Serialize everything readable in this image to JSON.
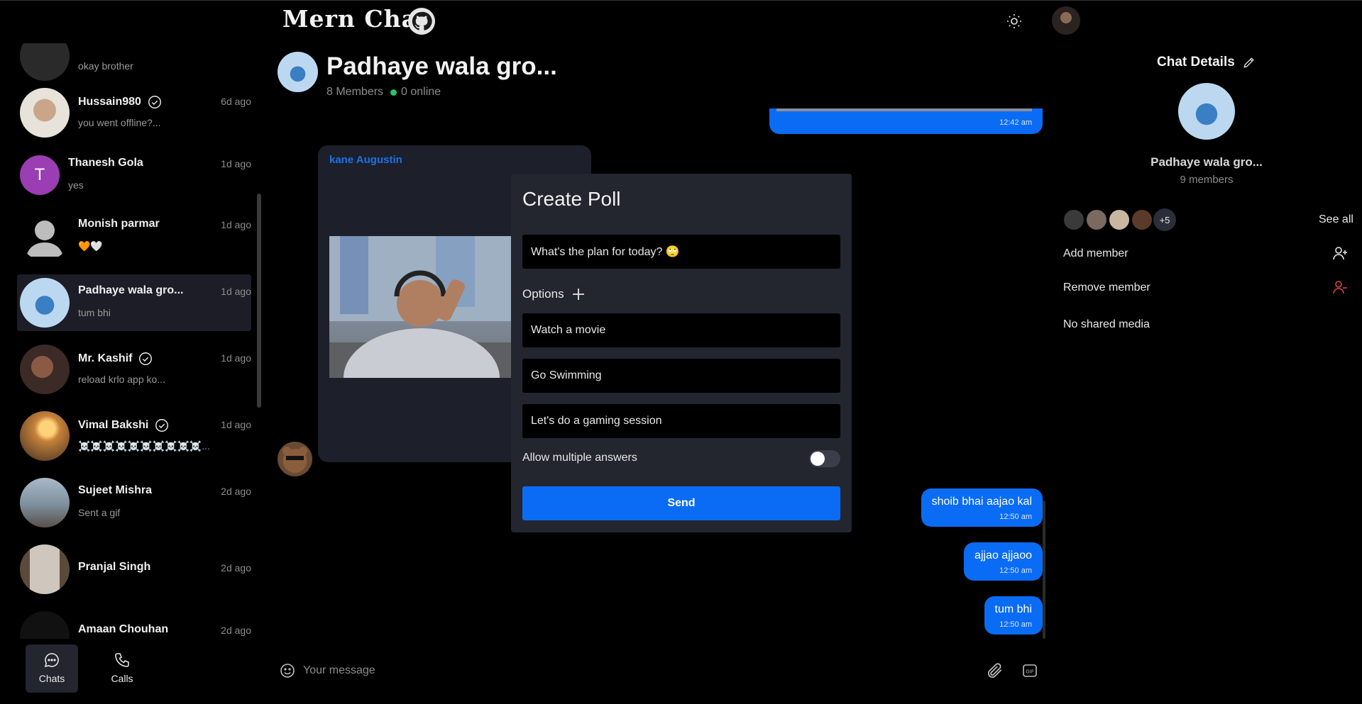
{
  "header": {
    "app_title": "Mern Chat",
    "icons": {
      "github": "github-icon",
      "theme": "sun-icon",
      "profile": "avatar"
    }
  },
  "sidebar": {
    "chats": [
      {
        "name": "",
        "message": "okay brother",
        "time": "",
        "verified": false
      },
      {
        "name": "Hussain980",
        "message": "you went offline?...",
        "time": "6d ago",
        "verified": true
      },
      {
        "name": "Thanesh Gola",
        "message": "yes",
        "time": "1d ago",
        "verified": false,
        "initial": "T"
      },
      {
        "name": "Monish parmar",
        "message": "🧡🤍",
        "time": "1d ago",
        "verified": false
      },
      {
        "name": "Padhaye wala gro...",
        "message": "tum bhi",
        "time": "1d ago",
        "verified": false,
        "active": true
      },
      {
        "name": "Mr. Kashif",
        "message": "reload krlo app ko...",
        "time": "1d ago",
        "verified": true
      },
      {
        "name": "Vimal Bakshi",
        "message": "☠️☠️☠️☠️☠️☠️☠️☠️☠️☠️...",
        "time": "1d ago",
        "verified": true
      },
      {
        "name": "Sujeet Mishra",
        "message": "Sent a gif",
        "time": "2d ago",
        "verified": false
      },
      {
        "name": "Pranjal Singh",
        "message": "",
        "time": "2d ago",
        "verified": false
      },
      {
        "name": "Amaan Chouhan",
        "message": "",
        "time": "2d ago",
        "verified": false
      }
    ],
    "nav": {
      "chats_label": "Chats",
      "calls_label": "Calls"
    }
  },
  "chat": {
    "title": "Padhaye wala gro...",
    "members": "8 Members",
    "online": "0 online",
    "messages": {
      "top_time": "12:42 am",
      "gif_sender": "kane Augustin",
      "out": [
        {
          "text": "shoib bhai aajao kal",
          "time": "12:50 am"
        },
        {
          "text": "ajjao ajjaoo",
          "time": "12:50 am"
        },
        {
          "text": "tum bhi",
          "time": "12:50 am"
        }
      ]
    },
    "input_placeholder": "Your message"
  },
  "poll": {
    "title": "Create Poll",
    "question": "What's the plan for today? 🙄",
    "options_label": "Options",
    "options": [
      "Watch a movie",
      "Go Swimming",
      "Let's do a gaming session"
    ],
    "multi_label": "Allow multiple answers",
    "multi_enabled": false,
    "send_label": "Send"
  },
  "details": {
    "title": "Chat Details",
    "group_name": "Padhaye wala gro...",
    "member_count": "9 members",
    "more_members": "+5",
    "see_all": "See all",
    "add_member": "Add member",
    "remove_member": "Remove member",
    "no_media": "No shared media"
  },
  "colors": {
    "accent": "#0a6cf5",
    "online": "#27c46a",
    "remove": "#e0443e"
  }
}
